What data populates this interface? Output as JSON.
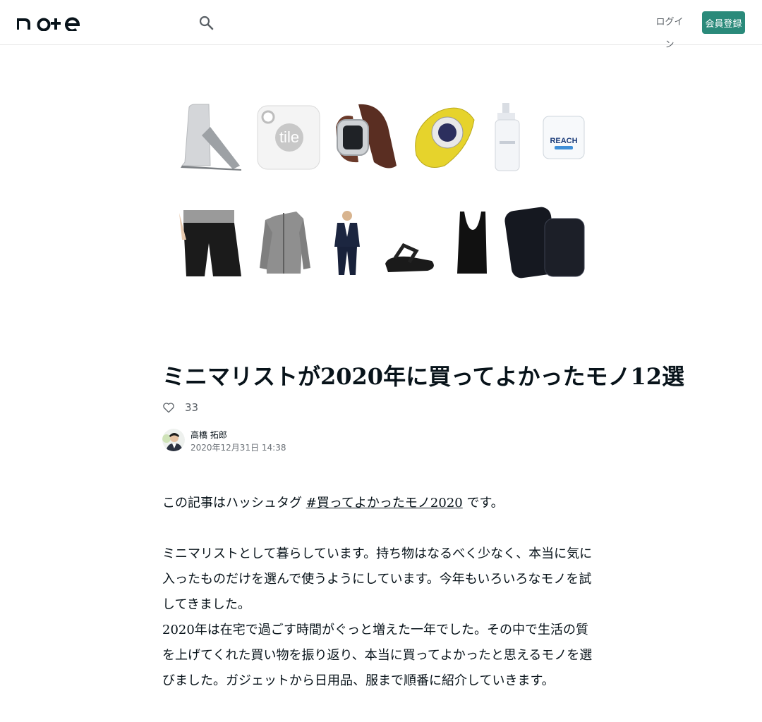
{
  "header": {
    "logo_text": "note",
    "login_label": "ログイン",
    "signup_label": "会員登録"
  },
  "article": {
    "title": "ミニマリストが2020年に買ってよかったモノ12選",
    "like_count": "33",
    "author": {
      "name": "高橋 拓郎",
      "date": "2020年12月31日 14:38"
    },
    "paragraphs": [
      {
        "prefix": "この記事はハッシュタグ ",
        "hashtag": "#買ってよかったモノ2020",
        "suffix": " です。"
      },
      {
        "text": "ミニマリストとして暮らしています。持ち物はなるべく少なく、本当に気に入ったものだけを選んで使うようにしています。今年もいろいろなモノを試してきました。"
      },
      {
        "text": "2020年は在宅で過ごす時間がぐっと増えた一年でした。その中で生活の質を上げてくれた買い物を振り返り、本当に買ってよかったと思えるモノを選びました。ガジェットから日用品、服まで順番に紹介していきます。"
      }
    ]
  },
  "hero": {
    "items": [
      "laptop-stand",
      "tile-tracker",
      "apple-watch-leather-band",
      "label-maker",
      "lotion-bottle",
      "reach-dental-floss",
      "black-shorts",
      "gray-fleece-jacket",
      "navy-suit",
      "black-sandals",
      "black-tank-top",
      "black-laptop-cases"
    ]
  },
  "colors": {
    "accent": "#2a8a7a",
    "text": "#08131a",
    "muted": "#6c7278"
  }
}
